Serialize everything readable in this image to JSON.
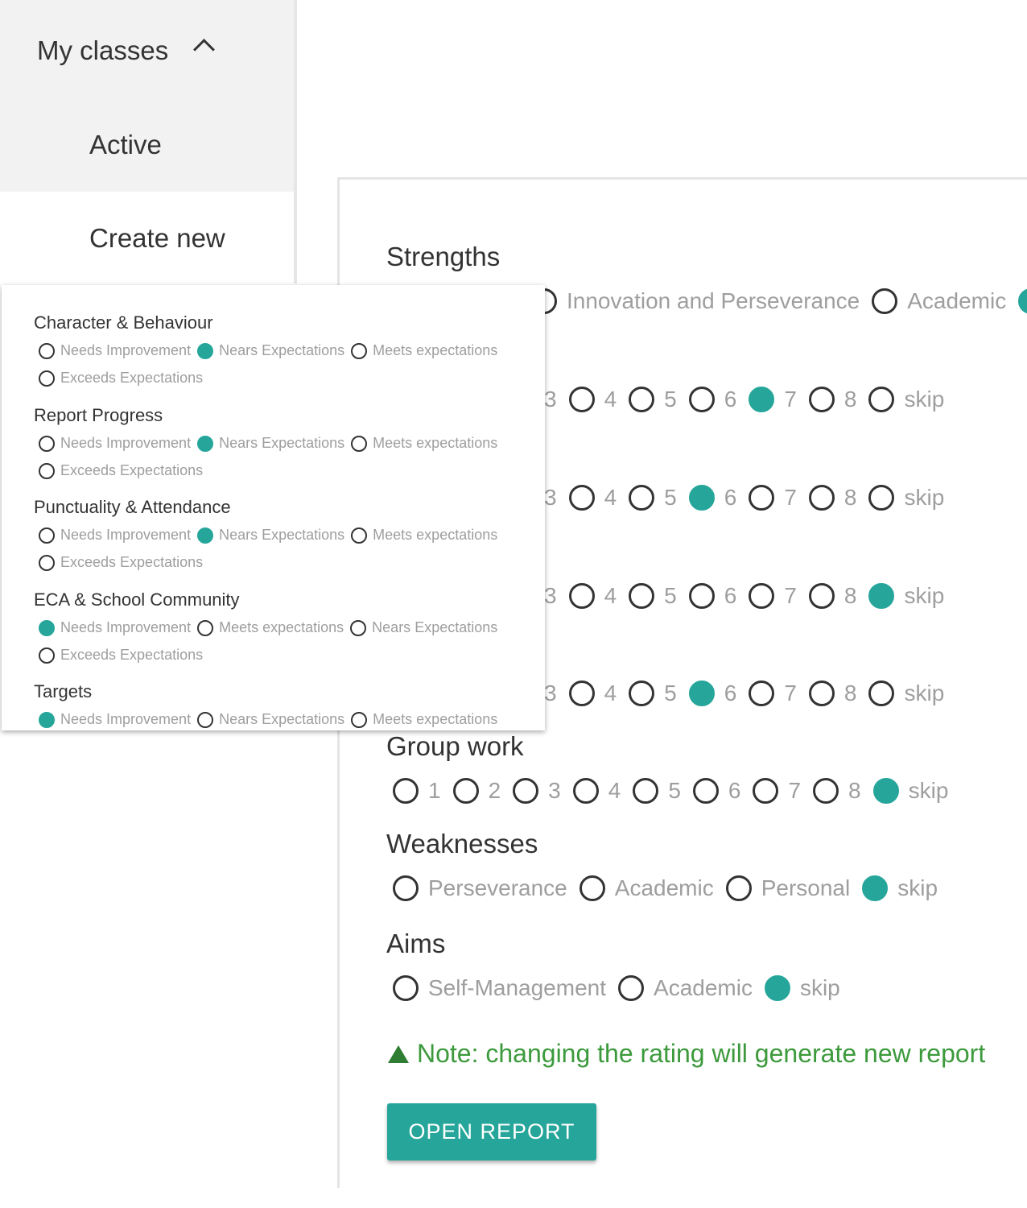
{
  "sidebar": {
    "my_classes": "My classes",
    "active": "Active",
    "create_new": "Create new"
  },
  "main": {
    "strengths_title": "Strengths",
    "strengths_options": [
      {
        "label": "Innovation and Perseverance",
        "selected": false
      },
      {
        "label": "Academic",
        "selected": false
      }
    ],
    "rating_rows": [
      {
        "visible": [
          "3",
          "4",
          "5",
          "6",
          "7",
          "8",
          "skip"
        ],
        "selected": "7"
      },
      {
        "visible": [
          "3",
          "4",
          "5",
          "6",
          "7",
          "8",
          "skip"
        ],
        "selected": "6"
      },
      {
        "visible": [
          "3",
          "4",
          "5",
          "6",
          "7",
          "8",
          "skip"
        ],
        "selected": "skip"
      },
      {
        "visible": [
          "3",
          "4",
          "5",
          "6",
          "7",
          "8",
          "skip"
        ],
        "selected": "6"
      }
    ],
    "group_work": {
      "title": "Group work",
      "options": [
        "1",
        "2",
        "3",
        "4",
        "5",
        "6",
        "7",
        "8",
        "skip"
      ],
      "selected": "skip"
    },
    "weaknesses": {
      "title": "Weaknesses",
      "options": [
        "Perseverance",
        "Academic",
        "Personal",
        "skip"
      ],
      "selected": "skip"
    },
    "aims": {
      "title": "Aims",
      "options": [
        "Self-Management",
        "Academic",
        "skip"
      ],
      "selected": "skip"
    },
    "note": "Note: changing the rating will generate new report",
    "open_report": "OPEN REPORT"
  },
  "popup": {
    "sections": [
      {
        "title": "Character & Behaviour",
        "options": [
          "Needs Improvement",
          "Nears Expectations",
          "Meets expectations",
          "Exceeds Expectations"
        ],
        "selected": "Nears Expectations"
      },
      {
        "title": "Report Progress",
        "options": [
          "Needs Improvement",
          "Nears Expectations",
          "Meets expectations",
          "Exceeds Expectations"
        ],
        "selected": "Nears Expectations"
      },
      {
        "title": "Punctuality & Attendance",
        "options": [
          "Needs Improvement",
          "Nears Expectations",
          "Meets expectations",
          "Exceeds Expectations"
        ],
        "selected": "Nears Expectations"
      },
      {
        "title": "ECA & School Community",
        "options": [
          "Needs Improvement",
          "Meets expectations",
          "Nears Expectations",
          "Exceeds Expectations"
        ],
        "selected": "Needs Improvement"
      },
      {
        "title": "Targets",
        "options": [
          "Needs Improvement",
          "Nears Expectations",
          "Meets expectations"
        ],
        "selected": "Needs Improvement"
      }
    ]
  },
  "colors": {
    "accent": "#26a69a",
    "note": "#3c9a3c",
    "warning_icon": "#2e7d32"
  },
  "icons": {
    "collapse": "chevron-up-icon",
    "note": "warning-icon"
  }
}
